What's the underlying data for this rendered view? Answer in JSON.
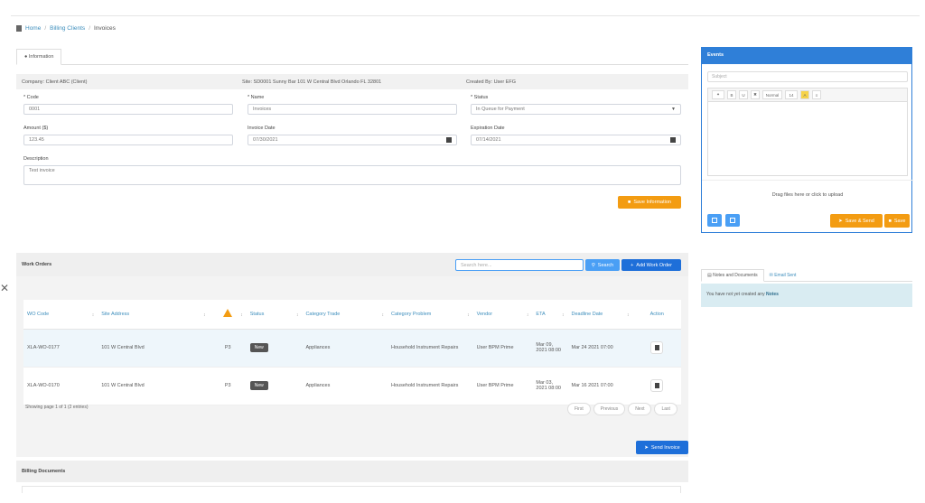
{
  "breadcrumb": {
    "home": "Home",
    "billing_clients": "Billing Clients",
    "current": "Invoices"
  },
  "tabs": {
    "information": "Information"
  },
  "info": {
    "company": "Company: Client ABC (Client)",
    "site": "Site: SD0001 Sunny Bar 101 W Central Blvd Orlando FL 32801",
    "created_by": "Created By: User EFG"
  },
  "form": {
    "code_label": "* Code",
    "code_value": "0001",
    "name_label": "* Name",
    "name_value": "Invoices",
    "status_label": "* Status",
    "status_value": "In Queue for Payment",
    "amount_label": "Amount ($)",
    "amount_value": "123.45",
    "invoice_date_label": "Invoice Date",
    "invoice_date_value": "07/30/2021",
    "expiration_date_label": "Expiration Date",
    "expiration_date_value": "07/14/2021",
    "description_label": "Description",
    "description_value": "Test invoice",
    "save_label": "Save Information"
  },
  "work_orders": {
    "title": "Work Orders",
    "search_placeholder": "Search here...",
    "search_label": "Search",
    "add_label": "Add Work Order",
    "columns": {
      "wo_code": "WO Code",
      "site_address": "Site Address",
      "status": "Status",
      "category_trade": "Category Trade",
      "category_problem": "Category Problem",
      "vendor": "Vendor",
      "eta": "ETA",
      "deadline_date": "Deadline Date",
      "action": "Action"
    },
    "rows": [
      {
        "wo_code": "XLA-WO-0177",
        "site_address": "101 W Central Blvd",
        "priority": "P3",
        "status": "New",
        "category_trade": "Appliances",
        "category_problem": "Household Instrument Repairs",
        "vendor": "User BPM Prime",
        "eta": "Mar 09, 2021 08:00",
        "deadline": "Mar 24 2021 07:00"
      },
      {
        "wo_code": "XLA-WO-0170",
        "site_address": "101 W Central Blvd",
        "priority": "P3",
        "status": "New",
        "category_trade": "Appliances",
        "category_problem": "Household Instrument Repairs",
        "vendor": "User BPM Prime",
        "eta": "Mar 03, 2021 08:00",
        "deadline": "Mar 16 2021 07:00"
      }
    ],
    "showing": "Showing page 1 of 1 (2 entries)",
    "pager": {
      "first": "First",
      "previous": "Previous",
      "next": "Next",
      "last": "Last"
    }
  },
  "send_invoice_label": "Send Invoice",
  "billing_documents": {
    "title": "Billing Documents"
  },
  "events": {
    "title": "Events",
    "subject_placeholder": "Subject",
    "toolbar": {
      "style": "Normal",
      "size": "14"
    },
    "drop_text": "Drag files here or click to upload",
    "save_send_label": "Save & Send",
    "save_label": "Save"
  },
  "right_tabs": {
    "notes_docs": "Notes and Documents",
    "email_sent": "Email Sent"
  },
  "notice": {
    "text": "You have not yet created any",
    "link": "Notes"
  },
  "colors": {
    "link": "#3c8dbc",
    "primary": "#1e6fd9",
    "accent_orange": "#f39c12",
    "panel_blue": "#2f7fd8",
    "notice_bg": "#d9ecf2"
  }
}
